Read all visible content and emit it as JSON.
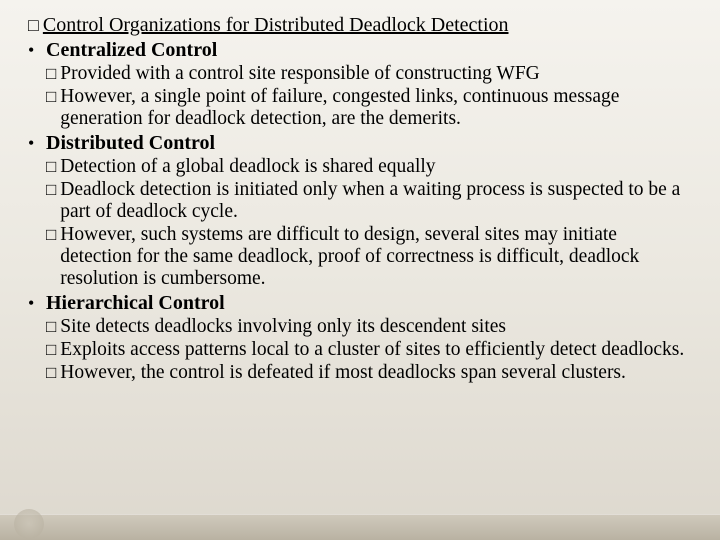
{
  "title": "Control Organizations for Distributed Deadlock Detection",
  "sections": [
    {
      "heading": "Centralized Control",
      "items": [
        "Provided with a control site responsible of constructing WFG",
        "However, a single point of failure, congested links, continuous message generation for deadlock detection, are the demerits."
      ]
    },
    {
      "heading": "Distributed Control",
      "items": [
        "Detection of a global deadlock is shared equally",
        "Deadlock detection is initiated only when a waiting process is suspected to be a part of deadlock cycle.",
        "However, such systems are difficult to design, several sites may initiate detection for the same deadlock, proof of correctness is difficult, deadlock resolution is cumbersome."
      ]
    },
    {
      "heading": "Hierarchical Control",
      "items": [
        "Site detects deadlocks involving only its descendent sites",
        "Exploits access patterns local to a cluster of sites to efficiently detect deadlocks.",
        "However, the control is defeated if most deadlocks span several clusters."
      ]
    }
  ]
}
